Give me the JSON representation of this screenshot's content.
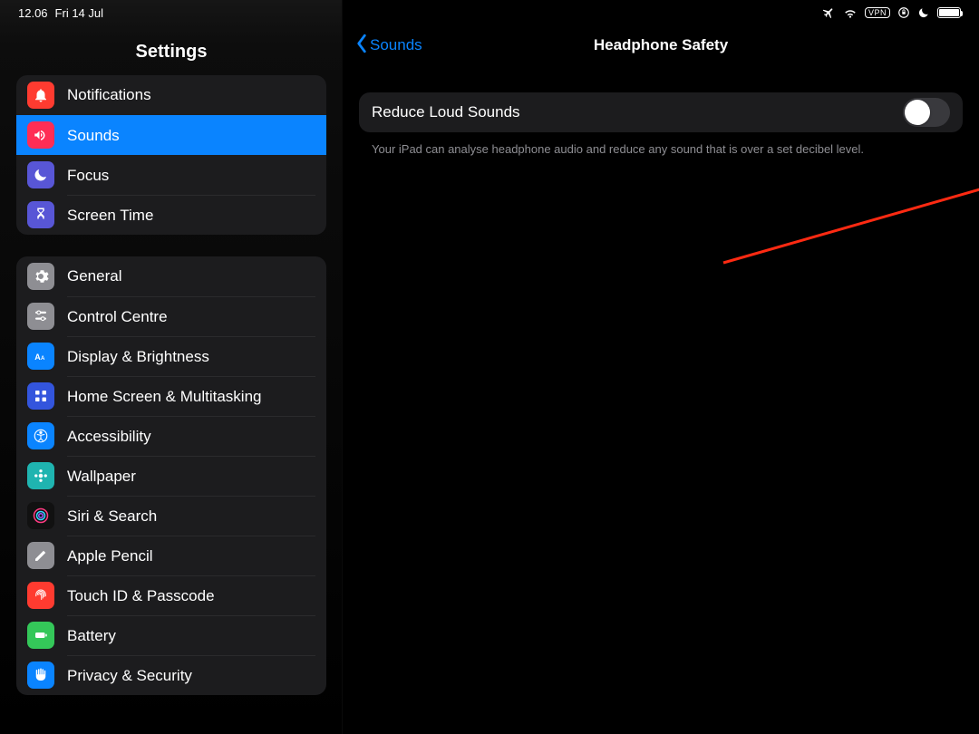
{
  "status": {
    "time": "12.06",
    "date": "Fri 14 Jul",
    "vpn": "VPN"
  },
  "sidebar": {
    "title": "Settings",
    "group1": [
      {
        "label": "Notifications",
        "bg": "#ff3b30"
      },
      {
        "label": "Sounds",
        "bg": "#ff3b30",
        "selected": true
      },
      {
        "label": "Focus",
        "bg": "#5856d6"
      },
      {
        "label": "Screen Time",
        "bg": "#5856d6"
      }
    ],
    "group2": [
      {
        "label": "General",
        "bg": "#8e8e93"
      },
      {
        "label": "Control Centre",
        "bg": "#8e8e93"
      },
      {
        "label": "Display & Brightness",
        "bg": "#0a84ff"
      },
      {
        "label": "Home Screen & Multitasking",
        "bg": "#3355dd"
      },
      {
        "label": "Accessibility",
        "bg": "#0a84ff"
      },
      {
        "label": "Wallpaper",
        "bg": "#1fb4b0"
      },
      {
        "label": "Siri & Search",
        "bg": "#222"
      },
      {
        "label": "Apple Pencil",
        "bg": "#8e8e93"
      },
      {
        "label": "Touch ID & Passcode",
        "bg": "#ff3b30"
      },
      {
        "label": "Battery",
        "bg": "#34c759"
      },
      {
        "label": "Privacy & Security",
        "bg": "#0a84ff"
      }
    ]
  },
  "detail": {
    "back_label": "Sounds",
    "title": "Headphone Safety",
    "row_label": "Reduce Loud Sounds",
    "toggle_on": false,
    "footer": "Your iPad can analyse headphone audio and reduce any sound that is over a set decibel level."
  }
}
